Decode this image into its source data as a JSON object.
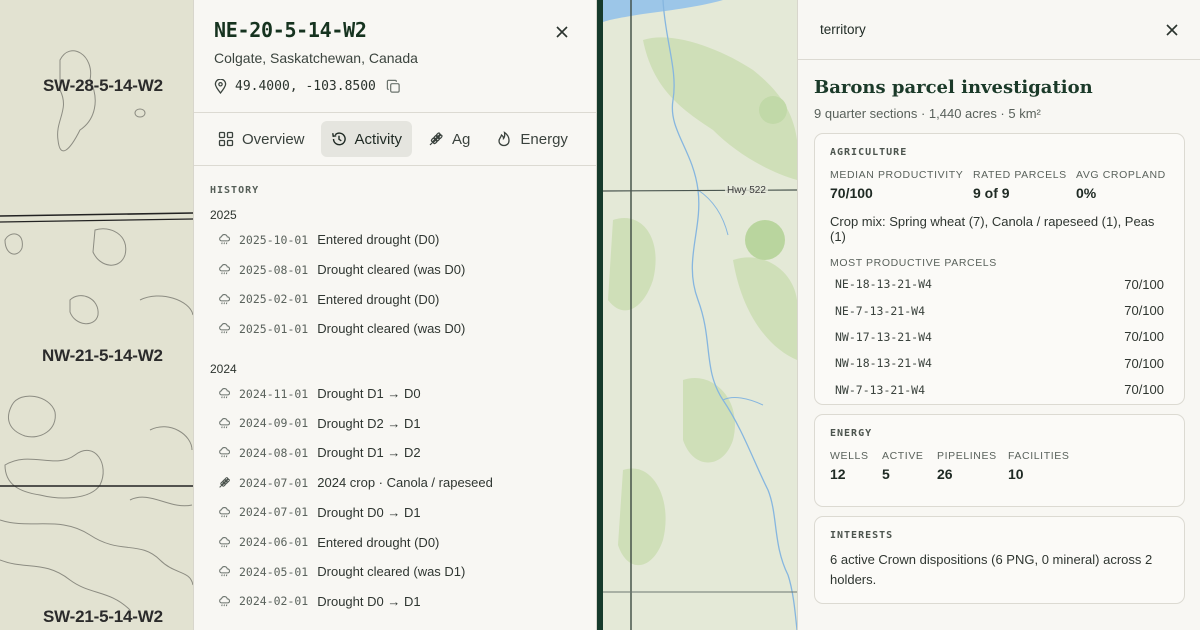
{
  "map_left": {
    "labels": [
      "SW-28-5-14-W2",
      "NW-21-5-14-W2",
      "SW-21-5-14-W2"
    ]
  },
  "parcel": {
    "title": "NE-20-5-14-W2",
    "location": "Colgate, Saskatchewan, Canada",
    "coordinates": "49.4000, -103.8500",
    "tabs": [
      {
        "label": "Overview",
        "icon": "grid-icon"
      },
      {
        "label": "Activity",
        "icon": "history-icon",
        "active": true
      },
      {
        "label": "Ag",
        "icon": "wheat-icon"
      },
      {
        "label": "Energy",
        "icon": "flame-icon"
      }
    ],
    "history_label": "HISTORY",
    "years": [
      {
        "year": "2025",
        "events": [
          {
            "icon": "drought-icon",
            "date": "2025-10-01",
            "text": "Entered drought (D0)"
          },
          {
            "icon": "drought-icon",
            "date": "2025-08-01",
            "text": "Drought cleared (was D0)"
          },
          {
            "icon": "drought-icon",
            "date": "2025-02-01",
            "text": "Entered drought (D0)"
          },
          {
            "icon": "drought-icon",
            "date": "2025-01-01",
            "text": "Drought cleared (was D0)"
          }
        ]
      },
      {
        "year": "2024",
        "events": [
          {
            "icon": "drought-icon",
            "date": "2024-11-01",
            "text": "Drought D1 → D0"
          },
          {
            "icon": "drought-icon",
            "date": "2024-09-01",
            "text": "Drought D2 → D1"
          },
          {
            "icon": "drought-icon",
            "date": "2024-08-01",
            "text": "Drought D1 → D2"
          },
          {
            "icon": "wheat-icon",
            "date": "2024-07-01",
            "text": "2024 crop · Canola / rapeseed"
          },
          {
            "icon": "drought-icon",
            "date": "2024-07-01",
            "text": "Drought D0 → D1"
          },
          {
            "icon": "drought-icon",
            "date": "2024-06-01",
            "text": "Entered drought (D0)"
          },
          {
            "icon": "drought-icon",
            "date": "2024-05-01",
            "text": "Drought cleared (was D1)"
          },
          {
            "icon": "drought-icon",
            "date": "2024-02-01",
            "text": "Drought D0 → D1"
          }
        ]
      }
    ]
  },
  "map_mid": {
    "road_label": "Hwy 522"
  },
  "territory": {
    "header": "territory",
    "title": "Barons parcel investigation",
    "subtitle": "9 quarter sections · 1,440 acres · 5 km²",
    "agriculture": {
      "title": "AGRICULTURE",
      "stats": [
        {
          "label": "MEDIAN PRODUCTIVITY",
          "value": "70/100"
        },
        {
          "label": "RATED PARCELS",
          "value": "9 of 9"
        },
        {
          "label": "AVG CROPLAND",
          "value": "0%"
        }
      ],
      "crop_mix": "Crop mix: Spring wheat (7), Canola / rapeseed (1), Peas (1)",
      "most_productive_label": "MOST PRODUCTIVE PARCELS",
      "parcels": [
        {
          "id": "NE-18-13-21-W4",
          "score": "70/100"
        },
        {
          "id": "NE-7-13-21-W4",
          "score": "70/100"
        },
        {
          "id": "NW-17-13-21-W4",
          "score": "70/100"
        },
        {
          "id": "NW-18-13-21-W4",
          "score": "70/100"
        },
        {
          "id": "NW-7-13-21-W4",
          "score": "70/100"
        }
      ]
    },
    "energy": {
      "title": "ENERGY",
      "stats": [
        {
          "label": "WELLS",
          "value": "12"
        },
        {
          "label": "ACTIVE",
          "value": "5"
        },
        {
          "label": "PIPELINES",
          "value": "26"
        },
        {
          "label": "FACILITIES",
          "value": "10"
        }
      ]
    },
    "interests": {
      "title": "INTERESTS",
      "text": "6 active Crown dispositions (6 PNG, 0 mineral) across 2 holders."
    }
  },
  "colors": {
    "accent_dark": "#163a2b",
    "panel_bg": "#f8f7f3",
    "map_bg": "#e2e2d1"
  }
}
